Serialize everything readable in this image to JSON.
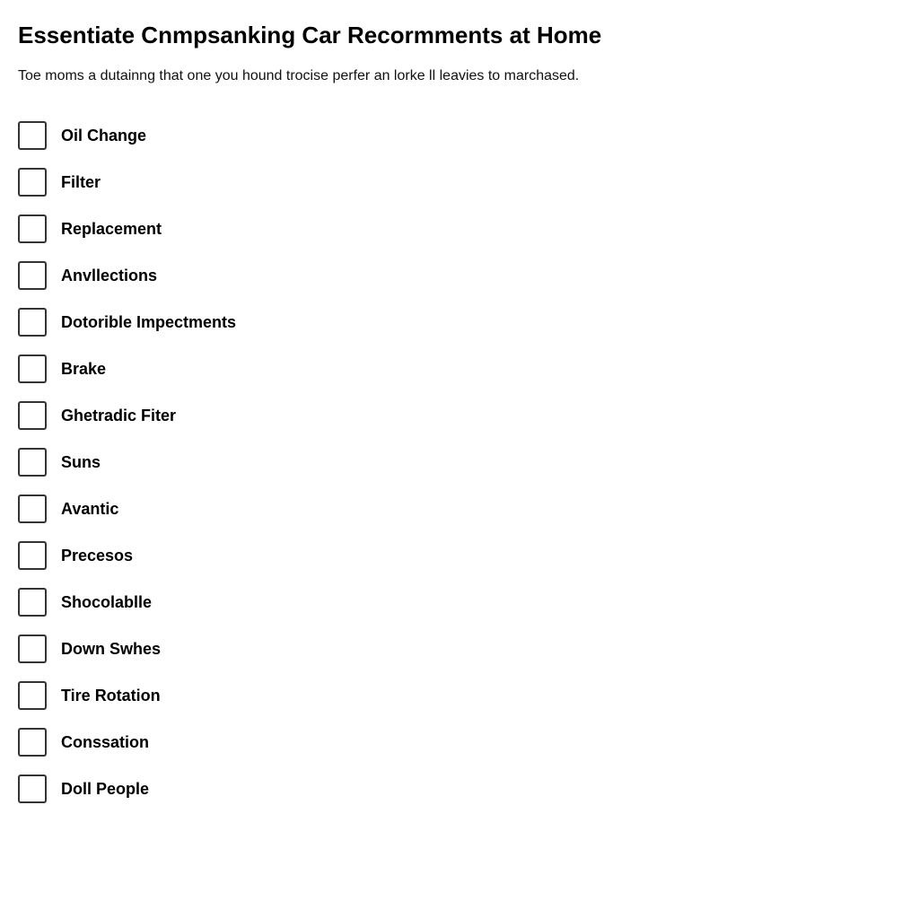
{
  "page": {
    "title": "Essentiate Cnmpsanking Car Recormments at Home",
    "description": "Toe moms a dutainng that one you hound trocise perfer an lorke ll leavies to marchased.",
    "checklist": [
      {
        "id": "oil-change",
        "label": "Oil Change"
      },
      {
        "id": "filter",
        "label": "Filter"
      },
      {
        "id": "replacement",
        "label": "Replacement"
      },
      {
        "id": "anvllections",
        "label": "Anvllections"
      },
      {
        "id": "dotorible-impectments",
        "label": "Dotorible Impectments"
      },
      {
        "id": "brake",
        "label": "Brake"
      },
      {
        "id": "ghetradic-fiter",
        "label": "Ghetradic Fiter"
      },
      {
        "id": "suns",
        "label": "Suns"
      },
      {
        "id": "avantic",
        "label": "Avantic"
      },
      {
        "id": "precesos",
        "label": "Precesos"
      },
      {
        "id": "shocolablle",
        "label": "Shocolablle"
      },
      {
        "id": "down-swhes",
        "label": "Down Swhes"
      },
      {
        "id": "tire-rotation",
        "label": "Tire Rotation"
      },
      {
        "id": "conssation",
        "label": "Conssation"
      },
      {
        "id": "doll-people",
        "label": "Doll People"
      }
    ]
  }
}
